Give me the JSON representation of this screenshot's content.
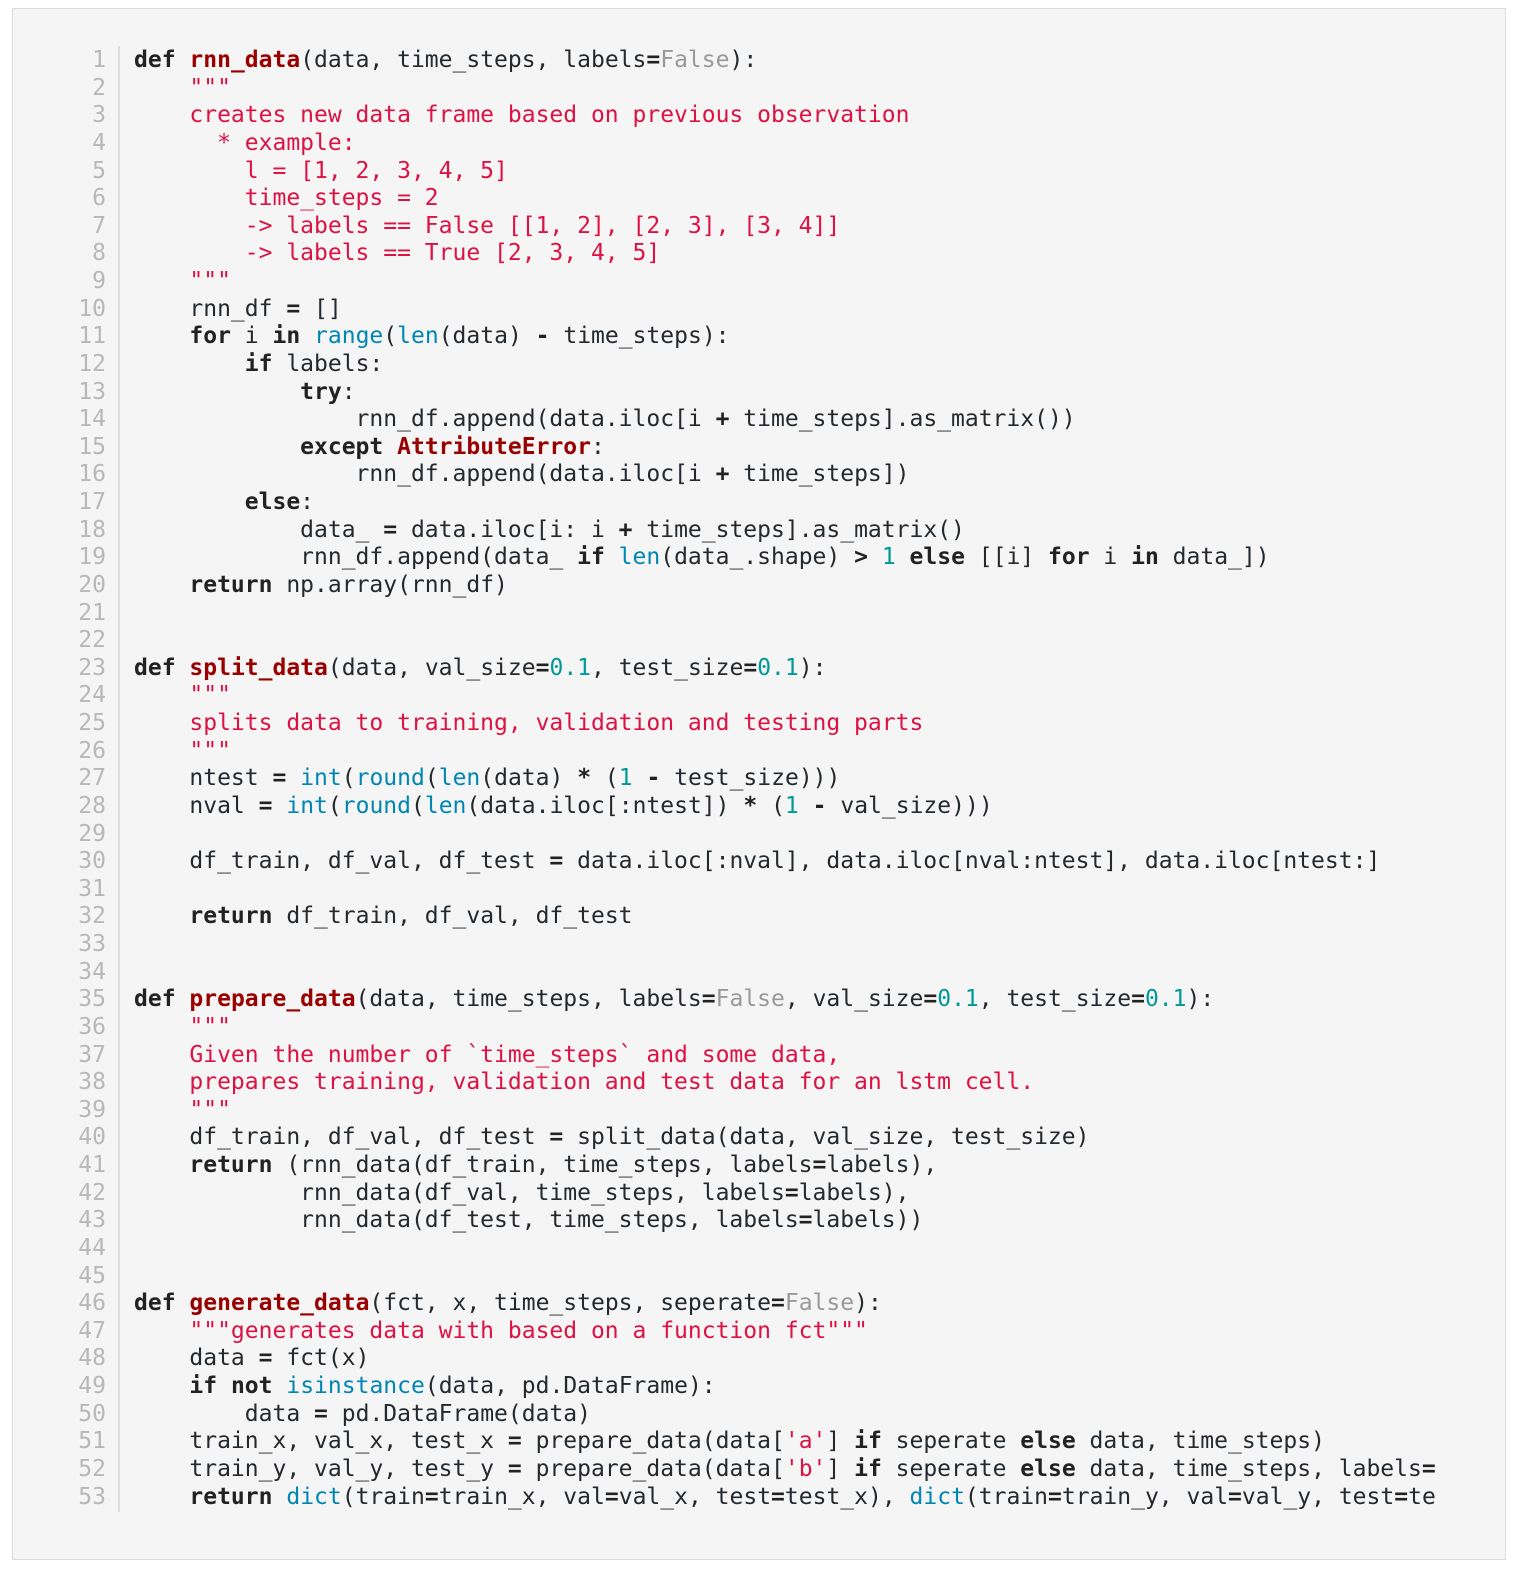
{
  "code_view": {
    "language": "python",
    "line_numbers": [
      "1",
      "2",
      "3",
      "4",
      "5",
      "6",
      "7",
      "8",
      "9",
      "10",
      "11",
      "12",
      "13",
      "14",
      "15",
      "16",
      "17",
      "18",
      "19",
      "20",
      "21",
      "22",
      "23",
      "24",
      "25",
      "26",
      "27",
      "28",
      "29",
      "30",
      "31",
      "32",
      "33",
      "34",
      "35",
      "36",
      "37",
      "38",
      "39",
      "40",
      "41",
      "42",
      "43",
      "44",
      "45",
      "46",
      "47",
      "48",
      "49",
      "50",
      "51",
      "52",
      "53"
    ],
    "lines": [
      [
        [
          "kw",
          "def"
        ],
        [
          "",
          "  "
        ],
        [
          "fn",
          "rnn_data"
        ],
        [
          "",
          "(data, time_steps, labels"
        ],
        [
          "op",
          "="
        ],
        [
          "const",
          "False"
        ],
        [
          "",
          "):"
        ]
      ],
      [
        [
          "doc",
          "    \"\"\""
        ]
      ],
      [
        [
          "doc",
          "    creates new data frame based on previous observation"
        ]
      ],
      [
        [
          "doc",
          "      * example:"
        ]
      ],
      [
        [
          "doc",
          "        l = [1, 2, 3, 4, 5]"
        ]
      ],
      [
        [
          "doc",
          "        time_steps = 2"
        ]
      ],
      [
        [
          "doc",
          "        -> labels == False [[1, 2], [2, 3], [3, 4]]"
        ]
      ],
      [
        [
          "doc",
          "        -> labels == True [2, 3, 4, 5]"
        ]
      ],
      [
        [
          "doc",
          "    \"\"\""
        ]
      ],
      [
        [
          "",
          "    rnn_df "
        ],
        [
          "op",
          "="
        ],
        [
          "",
          " []"
        ]
      ],
      [
        [
          "",
          "    "
        ],
        [
          "kw",
          "for"
        ],
        [
          "",
          " i "
        ],
        [
          "kw",
          "in"
        ],
        [
          "",
          " "
        ],
        [
          "builtin",
          "range"
        ],
        [
          "",
          "("
        ],
        [
          "builtin",
          "len"
        ],
        [
          "",
          "(data) "
        ],
        [
          "op",
          "-"
        ],
        [
          "",
          " time_steps):"
        ]
      ],
      [
        [
          "",
          "        "
        ],
        [
          "kw",
          "if"
        ],
        [
          "",
          " labels:"
        ]
      ],
      [
        [
          "",
          "            "
        ],
        [
          "kw",
          "try"
        ],
        [
          "",
          ":"
        ]
      ],
      [
        [
          "",
          "                rnn_df.append(data.iloc[i "
        ],
        [
          "op",
          "+"
        ],
        [
          "",
          " time_steps].as_matrix())"
        ]
      ],
      [
        [
          "",
          "            "
        ],
        [
          "kw",
          "except"
        ],
        [
          "",
          " "
        ],
        [
          "exc",
          "AttributeError"
        ],
        [
          "",
          ":"
        ]
      ],
      [
        [
          "",
          "                rnn_df.append(data.iloc[i "
        ],
        [
          "op",
          "+"
        ],
        [
          "",
          " time_steps])"
        ]
      ],
      [
        [
          "",
          "        "
        ],
        [
          "kw",
          "else"
        ],
        [
          "",
          ":"
        ]
      ],
      [
        [
          "",
          "            data_ "
        ],
        [
          "op",
          "="
        ],
        [
          "",
          " data.iloc[i: i "
        ],
        [
          "op",
          "+"
        ],
        [
          "",
          " time_steps].as_matrix()"
        ]
      ],
      [
        [
          "",
          "            rnn_df.append(data_ "
        ],
        [
          "kw",
          "if"
        ],
        [
          "",
          " "
        ],
        [
          "builtin",
          "len"
        ],
        [
          "",
          "(data_.shape) "
        ],
        [
          "op",
          ">"
        ],
        [
          "",
          " "
        ],
        [
          "num",
          "1"
        ],
        [
          "",
          " "
        ],
        [
          "kw",
          "else"
        ],
        [
          "",
          " [[i] "
        ],
        [
          "kw",
          "for"
        ],
        [
          "",
          " i "
        ],
        [
          "kw",
          "in"
        ],
        [
          "",
          " data_])"
        ]
      ],
      [
        [
          "",
          "    "
        ],
        [
          "kw",
          "return"
        ],
        [
          "",
          " np.array(rnn_df)"
        ]
      ],
      [],
      [],
      [
        [
          "kw",
          "def"
        ],
        [
          "",
          " "
        ],
        [
          "fn",
          "split_data"
        ],
        [
          "",
          "(data, val_size"
        ],
        [
          "op",
          "="
        ],
        [
          "num",
          "0.1"
        ],
        [
          "",
          ", test_size"
        ],
        [
          "op",
          "="
        ],
        [
          "num",
          "0.1"
        ],
        [
          "",
          "):"
        ]
      ],
      [
        [
          "doc",
          "    \"\"\""
        ]
      ],
      [
        [
          "doc",
          "    splits data to training, validation and testing parts"
        ]
      ],
      [
        [
          "doc",
          "    \"\"\""
        ]
      ],
      [
        [
          "",
          "    ntest "
        ],
        [
          "op",
          "="
        ],
        [
          "",
          " "
        ],
        [
          "builtin",
          "int"
        ],
        [
          "",
          "("
        ],
        [
          "builtin",
          "round"
        ],
        [
          "",
          "("
        ],
        [
          "builtin",
          "len"
        ],
        [
          "",
          "(data) "
        ],
        [
          "op",
          "*"
        ],
        [
          "",
          " ("
        ],
        [
          "num",
          "1"
        ],
        [
          "",
          " "
        ],
        [
          "op",
          "-"
        ],
        [
          "",
          " test_size)))"
        ]
      ],
      [
        [
          "",
          "    nval "
        ],
        [
          "op",
          "="
        ],
        [
          "",
          " "
        ],
        [
          "builtin",
          "int"
        ],
        [
          "",
          "("
        ],
        [
          "builtin",
          "round"
        ],
        [
          "",
          "("
        ],
        [
          "builtin",
          "len"
        ],
        [
          "",
          "(data.iloc[:ntest]) "
        ],
        [
          "op",
          "*"
        ],
        [
          "",
          " ("
        ],
        [
          "num",
          "1"
        ],
        [
          "",
          " "
        ],
        [
          "op",
          "-"
        ],
        [
          "",
          " val_size)))"
        ]
      ],
      [],
      [
        [
          "",
          "    df_train, df_val, df_test "
        ],
        [
          "op",
          "="
        ],
        [
          "",
          " data.iloc[:nval], data.iloc[nval:ntest], data.iloc[ntest:]"
        ]
      ],
      [],
      [
        [
          "",
          "    "
        ],
        [
          "kw",
          "return"
        ],
        [
          "",
          " df_train, df_val, df_test"
        ]
      ],
      [],
      [],
      [
        [
          "kw",
          "def"
        ],
        [
          "",
          " "
        ],
        [
          "fn",
          "prepare_data"
        ],
        [
          "",
          "(data, time_steps, labels"
        ],
        [
          "op",
          "="
        ],
        [
          "const",
          "False"
        ],
        [
          "",
          ", val_size"
        ],
        [
          "op",
          "="
        ],
        [
          "num",
          "0.1"
        ],
        [
          "",
          ", test_size"
        ],
        [
          "op",
          "="
        ],
        [
          "num",
          "0.1"
        ],
        [
          "",
          "):"
        ]
      ],
      [
        [
          "doc",
          "    \"\"\""
        ]
      ],
      [
        [
          "doc",
          "    Given the number of `time_steps` and some data,"
        ]
      ],
      [
        [
          "doc",
          "    prepares training, validation and test data for an lstm cell."
        ]
      ],
      [
        [
          "doc",
          "    \"\"\""
        ]
      ],
      [
        [
          "",
          "    df_train, df_val, df_test "
        ],
        [
          "op",
          "="
        ],
        [
          "",
          " split_data(data, val_size, test_size)"
        ]
      ],
      [
        [
          "",
          "    "
        ],
        [
          "kw",
          "return"
        ],
        [
          "",
          " (rnn_data(df_train, time_steps, labels"
        ],
        [
          "op",
          "="
        ],
        [
          "",
          "labels),"
        ]
      ],
      [
        [
          "",
          "            rnn_data(df_val, time_steps, labels"
        ],
        [
          "op",
          "="
        ],
        [
          "",
          "labels),"
        ]
      ],
      [
        [
          "",
          "            rnn_data(df_test, time_steps, labels"
        ],
        [
          "op",
          "="
        ],
        [
          "",
          "labels))"
        ]
      ],
      [],
      [],
      [
        [
          "kw",
          "def"
        ],
        [
          "",
          " "
        ],
        [
          "fn",
          "generate_data"
        ],
        [
          "",
          "(fct, x, time_steps, seperate"
        ],
        [
          "op",
          "="
        ],
        [
          "const",
          "False"
        ],
        [
          "",
          "):"
        ]
      ],
      [
        [
          "doc",
          "    \"\"\"generates data with based on a function fct\"\"\""
        ]
      ],
      [
        [
          "",
          "    data "
        ],
        [
          "op",
          "="
        ],
        [
          "",
          " fct(x)"
        ]
      ],
      [
        [
          "",
          "    "
        ],
        [
          "kw",
          "if"
        ],
        [
          "",
          " "
        ],
        [
          "kw",
          "not"
        ],
        [
          "",
          " "
        ],
        [
          "builtin",
          "isinstance"
        ],
        [
          "",
          "(data, pd.DataFrame):"
        ]
      ],
      [
        [
          "",
          "        data "
        ],
        [
          "op",
          "="
        ],
        [
          "",
          " pd.DataFrame(data)"
        ]
      ],
      [
        [
          "",
          "    train_x, val_x, test_x "
        ],
        [
          "op",
          "="
        ],
        [
          "",
          " prepare_data(data["
        ],
        [
          "str",
          "'a'"
        ],
        [
          "",
          "] "
        ],
        [
          "kw",
          "if"
        ],
        [
          "",
          " seperate "
        ],
        [
          "kw",
          "else"
        ],
        [
          "",
          " data, time_steps)"
        ]
      ],
      [
        [
          "",
          "    train_y, val_y, test_y "
        ],
        [
          "op",
          "="
        ],
        [
          "",
          " prepare_data(data["
        ],
        [
          "str",
          "'b'"
        ],
        [
          "",
          "] "
        ],
        [
          "kw",
          "if"
        ],
        [
          "",
          " seperate "
        ],
        [
          "kw",
          "else"
        ],
        [
          "",
          " data, time_steps, labels"
        ],
        [
          "op",
          "="
        ]
      ],
      [
        [
          "",
          "    "
        ],
        [
          "kw",
          "return"
        ],
        [
          "",
          " "
        ],
        [
          "builtin",
          "dict"
        ],
        [
          "",
          "(train"
        ],
        [
          "op",
          "="
        ],
        [
          "",
          "train_x, val"
        ],
        [
          "op",
          "="
        ],
        [
          "",
          "val_x, test"
        ],
        [
          "op",
          "="
        ],
        [
          "",
          "test_x), "
        ],
        [
          "builtin",
          "dict"
        ],
        [
          "",
          "(train"
        ],
        [
          "op",
          "="
        ],
        [
          "",
          "train_y, val"
        ],
        [
          "op",
          "="
        ],
        [
          "",
          "val_y, test"
        ],
        [
          "op",
          "="
        ],
        [
          "",
          "te"
        ]
      ]
    ]
  },
  "colors": {
    "background": "#f5f5f5",
    "keyword": "#222222",
    "function_name": "#990000",
    "docstring": "#dd1144",
    "number": "#009999",
    "constant": "#999999",
    "builtin": "#0086b3",
    "line_number": "#b8b8b8"
  }
}
